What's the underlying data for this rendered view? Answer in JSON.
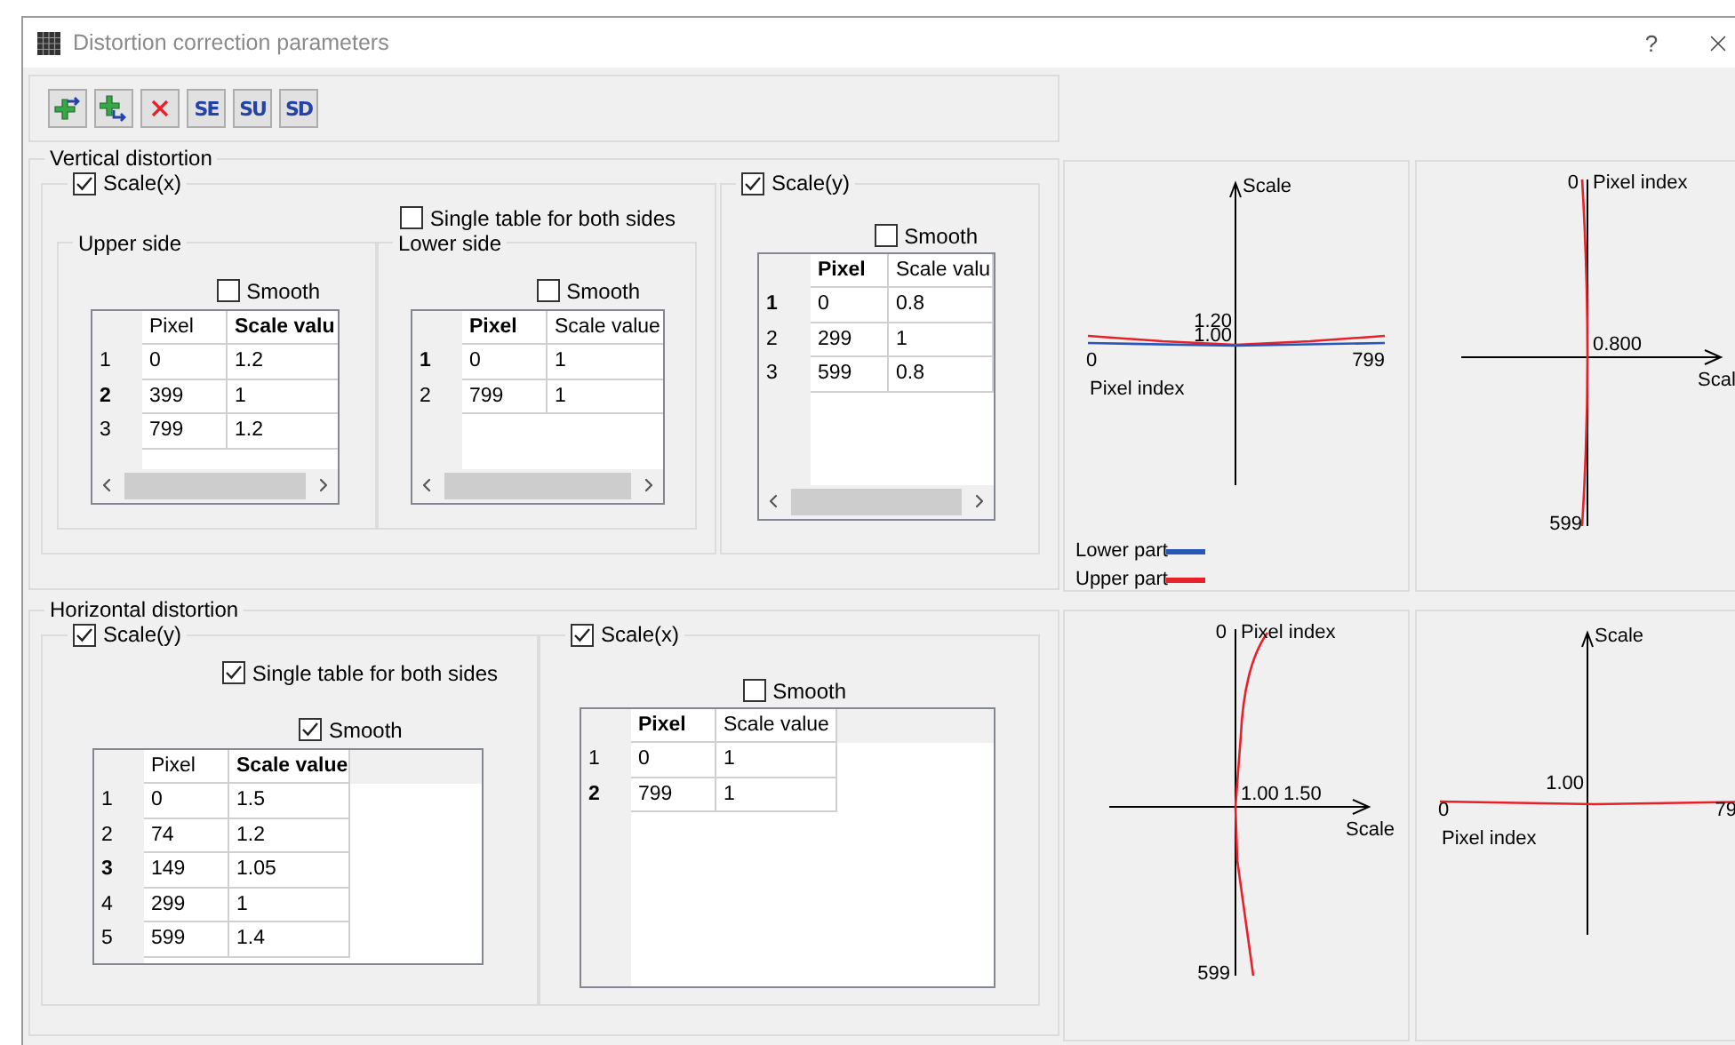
{
  "window": {
    "title": "Distortion correction parameters",
    "help": "?"
  },
  "toolbar": [
    {
      "kind": "plus-arrow"
    },
    {
      "kind": "plus-corner-arrow"
    },
    {
      "kind": "delete"
    },
    {
      "kind": "text",
      "label": "SE"
    },
    {
      "kind": "text",
      "label": "SU"
    },
    {
      "kind": "text",
      "label": "SD"
    }
  ],
  "vertical_distortion": {
    "title": "Vertical distortion",
    "scale_x": {
      "label": "Scale(x)",
      "checked": true,
      "single_table": {
        "label": "Single table for both sides",
        "checked": false
      },
      "upper": {
        "title": "Upper side",
        "smooth": {
          "label": "Smooth",
          "checked": false
        },
        "table": {
          "scrollbar": true,
          "columns": [
            {
              "label": "Pixel",
              "selected": false
            },
            {
              "label": "Scale valu",
              "selected": true
            }
          ],
          "rows": [
            {
              "number": "1",
              "selected": false,
              "cells": [
                "0",
                "1.2"
              ]
            },
            {
              "number": "2",
              "selected": true,
              "cells": [
                "399",
                "1"
              ]
            },
            {
              "number": "3",
              "selected": false,
              "cells": [
                "799",
                "1.2"
              ]
            }
          ]
        }
      },
      "lower": {
        "title": "Lower side",
        "smooth": {
          "label": "Smooth",
          "checked": false
        },
        "table": {
          "scrollbar": true,
          "columns": [
            {
              "label": "Pixel",
              "selected": true
            },
            {
              "label": "Scale value",
              "selected": false
            }
          ],
          "rows": [
            {
              "number": "1",
              "selected": true,
              "cells": [
                "0",
                "1"
              ]
            },
            {
              "number": "2",
              "selected": false,
              "cells": [
                "799",
                "1"
              ]
            }
          ]
        }
      }
    },
    "scale_y": {
      "label": "Scale(y)",
      "checked": true,
      "smooth": {
        "label": "Smooth",
        "checked": false
      },
      "table": {
        "scrollbar": true,
        "columns": [
          {
            "label": "Pixel",
            "selected": true
          },
          {
            "label": "Scale valu",
            "selected": false
          }
        ],
        "rows": [
          {
            "number": "1",
            "selected": true,
            "cells": [
              "0",
              "0.8"
            ]
          },
          {
            "number": "2",
            "selected": false,
            "cells": [
              "299",
              "1"
            ]
          },
          {
            "number": "3",
            "selected": false,
            "cells": [
              "599",
              "0.8"
            ]
          }
        ]
      }
    }
  },
  "horizontal_distortion": {
    "title": "Horizontal distortion",
    "scale_y": {
      "label": "Scale(y)",
      "checked": true,
      "single_table": {
        "label": "Single table for both sides",
        "checked": true
      },
      "smooth": {
        "label": "Smooth",
        "checked": true
      },
      "table": {
        "scrollbar": false,
        "columns": [
          {
            "label": "Pixel",
            "selected": false
          },
          {
            "label": "Scale value",
            "selected": true
          }
        ],
        "rows": [
          {
            "number": "1",
            "selected": false,
            "cells": [
              "0",
              "1.5"
            ]
          },
          {
            "number": "2",
            "selected": false,
            "cells": [
              "74",
              "1.2"
            ]
          },
          {
            "number": "3",
            "selected": true,
            "cells": [
              "149",
              "1.05"
            ]
          },
          {
            "number": "4",
            "selected": false,
            "cells": [
              "299",
              "1"
            ]
          },
          {
            "number": "5",
            "selected": false,
            "cells": [
              "599",
              "1.4"
            ]
          }
        ]
      }
    },
    "scale_x": {
      "label": "Scale(x)",
      "checked": true,
      "smooth": {
        "label": "Smooth",
        "checked": false
      },
      "table": {
        "scrollbar": false,
        "columns": [
          {
            "label": "Pixel",
            "selected": true
          },
          {
            "label": "Scale value",
            "selected": false
          }
        ],
        "rows": [
          {
            "number": "1",
            "selected": false,
            "cells": [
              "0",
              "1"
            ]
          },
          {
            "number": "2",
            "selected": true,
            "cells": [
              "799",
              "1"
            ]
          }
        ]
      }
    }
  },
  "plots": [
    {
      "kind": "pixel-x",
      "y_title": "Scale",
      "x_title": "Pixel index",
      "x_min": "0",
      "x_max": "799",
      "y_ticks": [
        "1.20",
        "1.00"
      ],
      "curves": [
        {
          "color": "#e8202a"
        },
        {
          "color": "#2a56b8"
        }
      ],
      "legend": [
        {
          "label": "Lower part",
          "color": "#2a56b8"
        },
        {
          "label": "Upper part",
          "color": "#e8202a"
        }
      ]
    },
    {
      "kind": "pixel-y",
      "y_title": "Pixel index",
      "x_title": "Scal",
      "y_min": "0",
      "y_max": "599",
      "x_ticks": [
        "0.800"
      ],
      "curves": [
        {
          "color": "#e8202a"
        }
      ]
    },
    {
      "kind": "pixel-y",
      "y_title": "Pixel index",
      "x_title": "Scale",
      "y_min": "0",
      "y_max": "599",
      "x_ticks": [
        "1.00",
        "1.50"
      ],
      "curves": [
        {
          "color": "#e8202a"
        }
      ]
    },
    {
      "kind": "pixel-x",
      "y_title": "Scale",
      "x_title": "Pixel index",
      "x_min": "0",
      "x_max": "79",
      "y_ticks": [
        "1.00"
      ],
      "curves": [
        {
          "color": "#e8202a"
        }
      ]
    }
  ]
}
